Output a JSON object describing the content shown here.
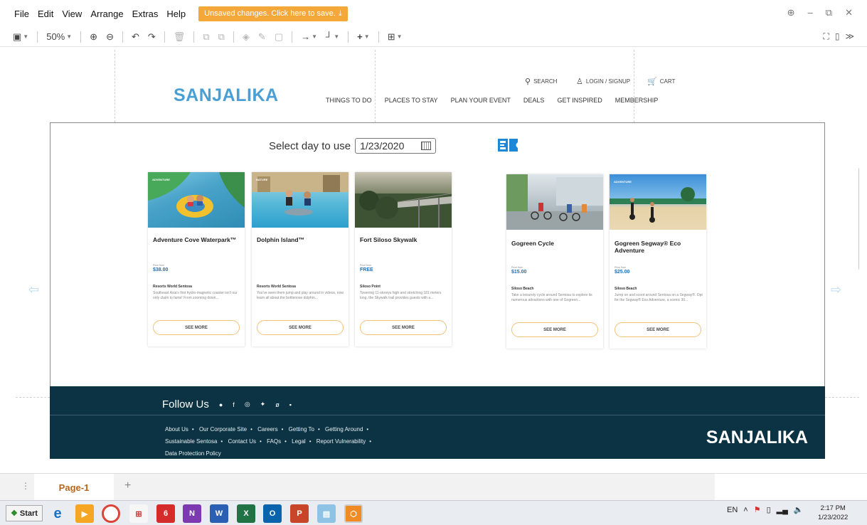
{
  "menu": {
    "items": [
      "File",
      "Edit",
      "View",
      "Arrange",
      "Extras",
      "Help"
    ],
    "save_notice": "Unsaved changes. Click here to save."
  },
  "toolbar": {
    "zoom": "50%"
  },
  "site": {
    "brand": "SANJALIKA",
    "search": "SEARCH",
    "login": "LOGIN / SIGNUP",
    "cart": "CART",
    "nav": [
      "THINGS TO DO",
      "PLACES TO STAY",
      "PLAN YOUR EVENT",
      "DEALS",
      "GET INSPIRED",
      "MEMBERSHIP"
    ]
  },
  "date_picker": {
    "label": "Select day to use",
    "value": "1/23/2020"
  },
  "cards": [
    {
      "tag": "ADVENTURE",
      "title": "Adventure Cove Waterpark™",
      "price_from": "Price from",
      "price": "$38.00",
      "location": "Resorts World Sentosa",
      "description": "Southeast Asia's first hydro-magnetic coaster isn't our only claim to fame! From zooming down...",
      "button": "SEE MORE"
    },
    {
      "tag": "NATURE",
      "title": "Dolphin Island™",
      "price_from": "",
      "price": "",
      "location": "Resorts World Sentosa",
      "description": "You've seen them jump and play around in videos, now learn all about the bottlenose dolphin...",
      "button": "SEE MORE"
    },
    {
      "tag": "",
      "title": "Fort Siloso Skywalk",
      "price_from": "Price from",
      "price": "FREE",
      "location": "Siloso Point",
      "description": "Towering 11-storeys high and stretching 181 meters long, the Skywalk trail provides guests with a...",
      "button": "SEE MORE"
    },
    {
      "tag": "",
      "title": "Gogreen Cycle",
      "price_from": "Price from",
      "price": "$15.00",
      "location": "Siloso Beach",
      "description": "Take a leisurely cycle around Sentosa to explore its numerous attractions with one of Gogreen...",
      "button": "SEE MORE"
    },
    {
      "tag": "ADVENTURE",
      "title": "Gogreen Segway® Eco Adventure",
      "price_from": "Price from",
      "price": "$25.00",
      "location": "Siloso Beach",
      "description": "Jump on and scoot around Sentosa on a Segway®. Opt for the Segway® Eco Adventure, a scenic 30...",
      "button": "SEE MORE"
    }
  ],
  "footer": {
    "follow": "Follow Us",
    "links_row1": [
      "About Us",
      "Our Corporate Site",
      "Careers",
      "Getting To",
      "Getting Around"
    ],
    "links_row2": [
      "Sustainable Sentosa",
      "Contact Us",
      "FAQs",
      "Legal",
      "Report Vulnerability"
    ],
    "links_row3": [
      "Data Protection Policy"
    ],
    "brand": "SANJALIKA"
  },
  "pages": {
    "tab": "Page-1"
  },
  "taskbar": {
    "start": "Start",
    "lang": "EN",
    "time": "2:17 PM",
    "date": "1/23/2022"
  }
}
